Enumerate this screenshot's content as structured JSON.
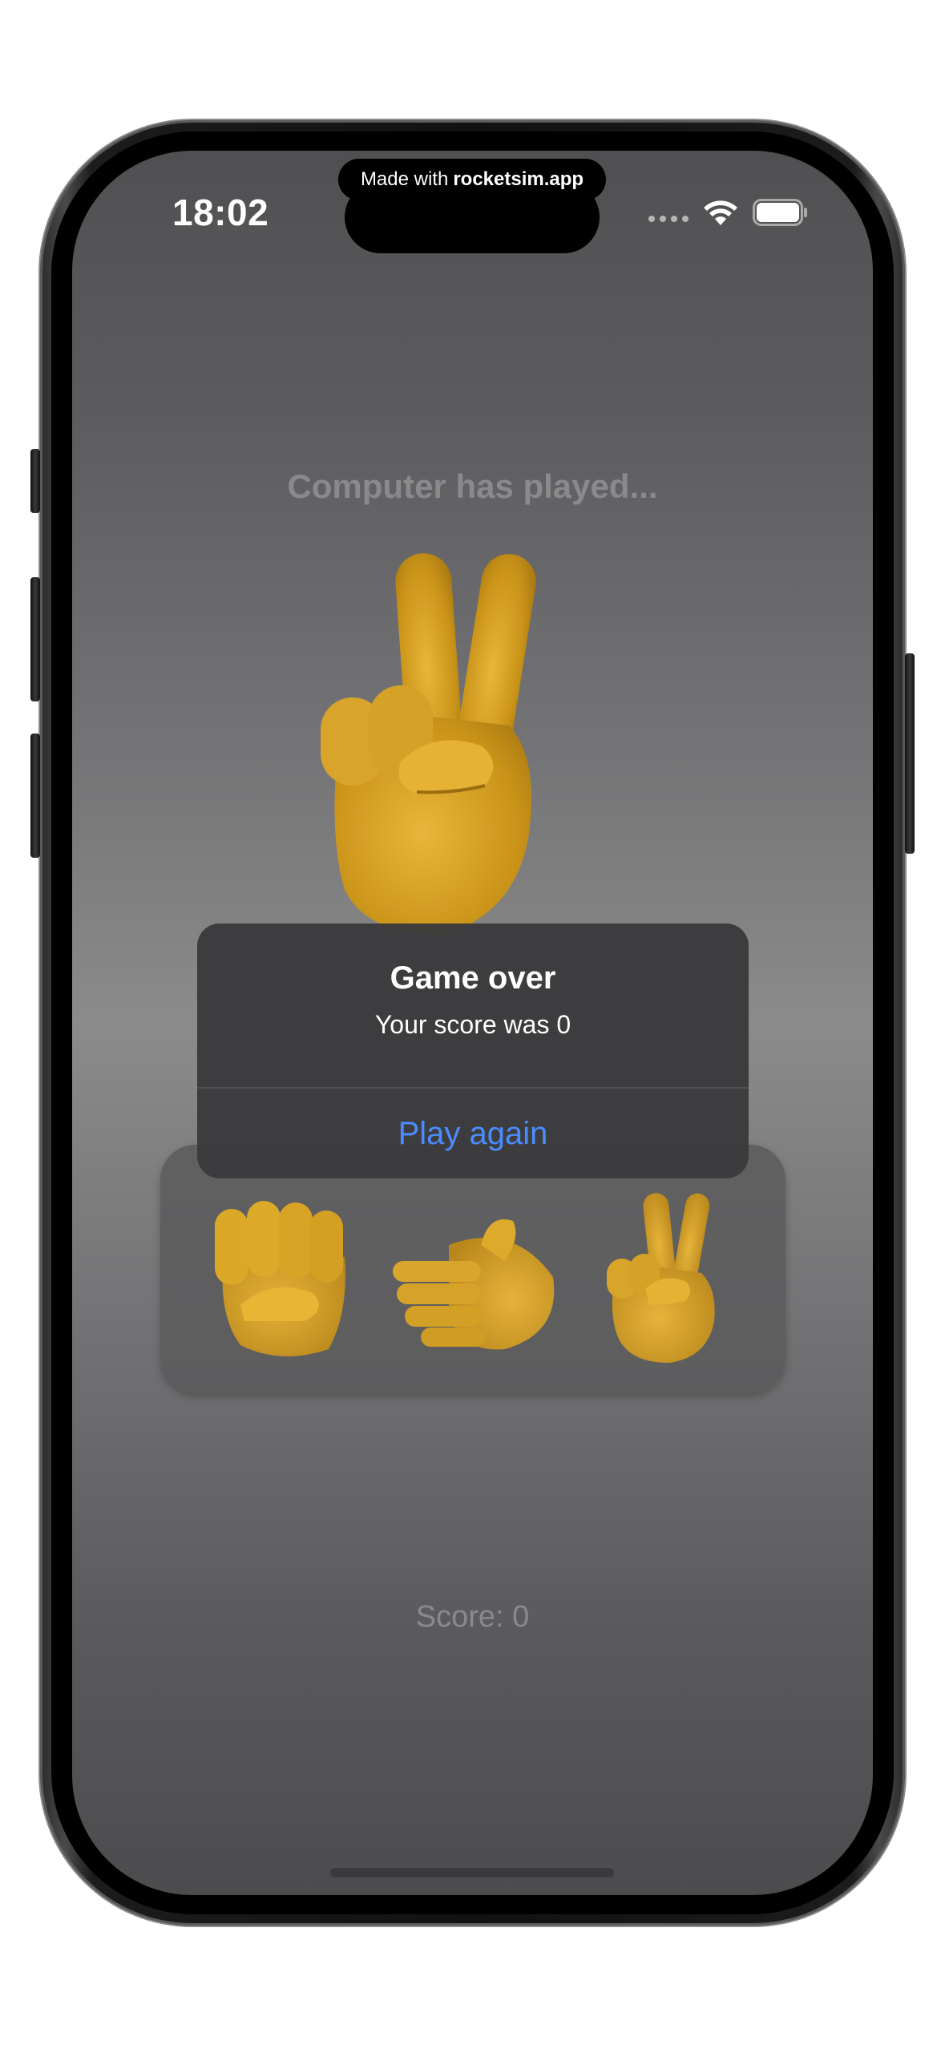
{
  "status_bar": {
    "time": "18:02",
    "made_with_prefix": "Made with",
    "made_with_brand": "rocketsim.app",
    "icons": [
      "cellular-signal-icon",
      "wifi-icon",
      "battery-icon"
    ]
  },
  "game": {
    "computer_label": "Computer has played...",
    "computer_choice": "scissors-hand-icon",
    "choices": [
      {
        "name": "rock-fist-icon"
      },
      {
        "name": "paper-hand-icon"
      },
      {
        "name": "scissors-hand-icon"
      }
    ],
    "score_text": "Score: 0"
  },
  "alert": {
    "title": "Game over",
    "message": "Your score was 0",
    "action_label": "Play again",
    "action_color": "#4a8cff"
  },
  "colors": {
    "emoji_skin": "#d9a21a",
    "label_gray": "#8a8a8c"
  }
}
